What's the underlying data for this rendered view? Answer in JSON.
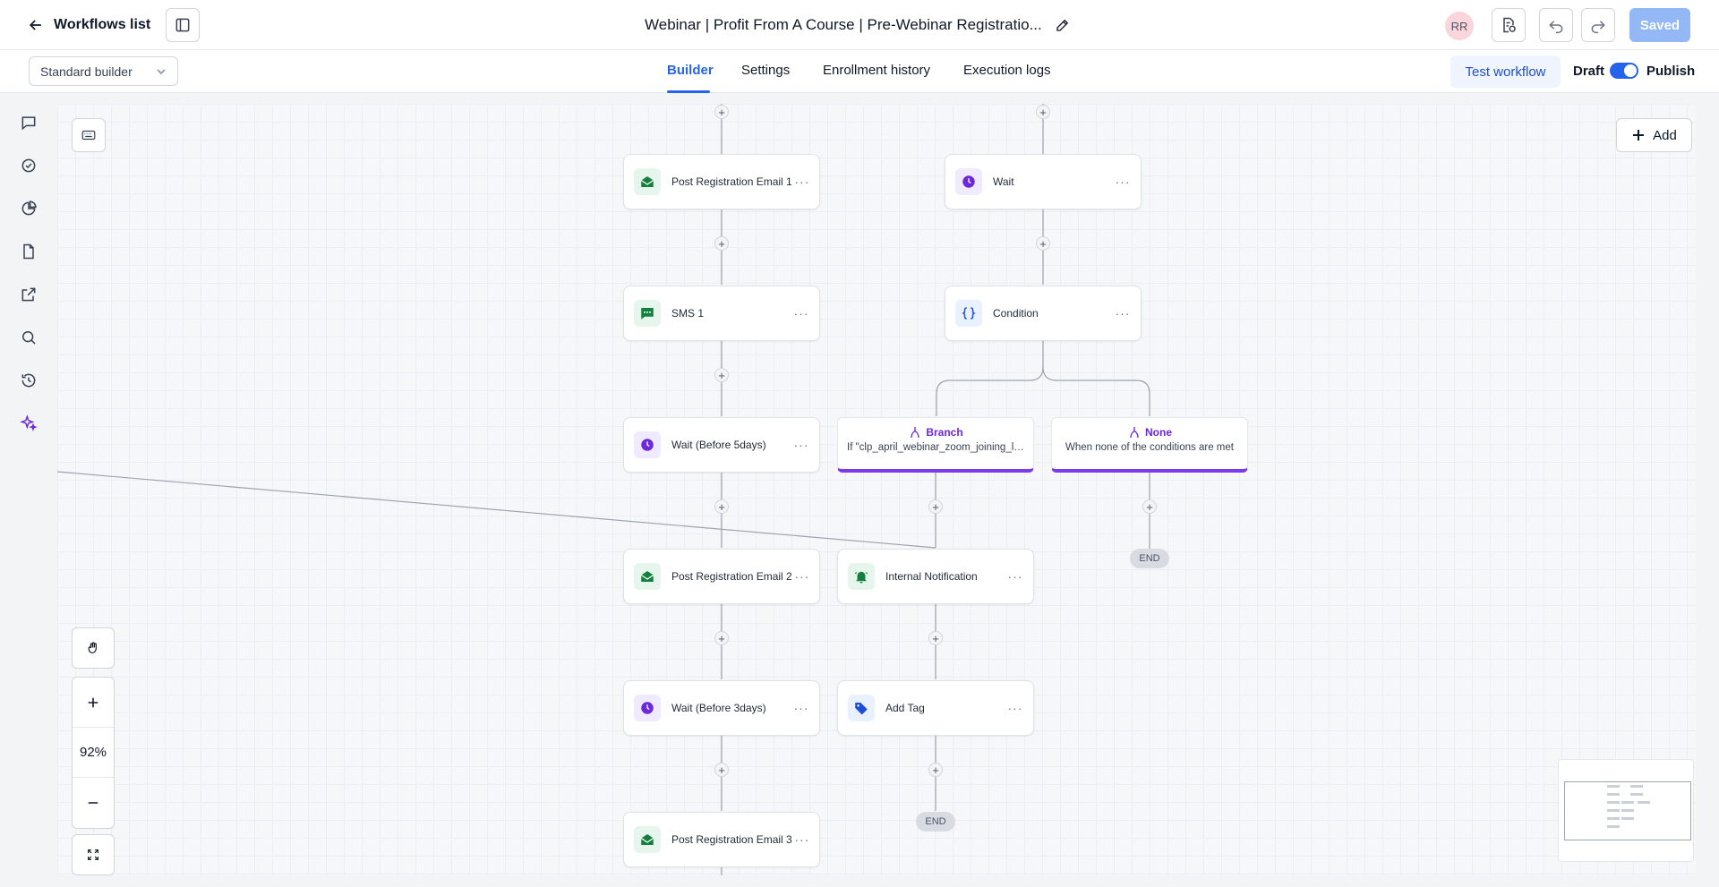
{
  "header": {
    "back_label": "Workflows list",
    "workflow_title": "Webinar | Profit From A Course | Pre-Webinar Registratio...",
    "avatar_initials": "RR",
    "saved_label": "Saved"
  },
  "subbar": {
    "builder_select": "Standard builder",
    "tabs": [
      {
        "label": "Builder",
        "active": true
      },
      {
        "label": "Settings",
        "active": false
      },
      {
        "label": "Enrollment history",
        "active": false
      },
      {
        "label": "Execution logs",
        "active": false
      }
    ],
    "test_workflow_label": "Test workflow",
    "draft_label": "Draft",
    "publish_label": "Publish",
    "toggle_on": true
  },
  "rail": [
    "chat-icon",
    "check-circle-icon",
    "pie-chart-icon",
    "file-icon",
    "external-link-icon",
    "search-icon",
    "history-icon",
    "sparkles-icon"
  ],
  "canvas": {
    "add_label": "Add",
    "zoom_level": "92%",
    "nodes": {
      "email1": "Post Registration Email 1",
      "sms1": "SMS 1",
      "wait5": "Wait (Before 5days)",
      "email2": "Post Registration Email 2",
      "wait3": "Wait (Before 3days)",
      "email3": "Post Registration Email 3",
      "wait": "Wait",
      "condition": "Condition",
      "internal": "Internal Notification",
      "tag": "Add Tag"
    },
    "branches": {
      "branch": {
        "title": "Branch",
        "desc": "If \"clp_april_webinar_zoom_joining_li..."
      },
      "none": {
        "title": "None",
        "desc": "When none of the conditions are met"
      }
    },
    "end_label": "END",
    "node_more": "···",
    "plus": "+"
  },
  "colors": {
    "accent": "#2563eb",
    "branch": "#7c3aed",
    "email_green": "#15803d",
    "wait_purple": "#6d28d9",
    "tag_blue": "#1d4ed8"
  }
}
